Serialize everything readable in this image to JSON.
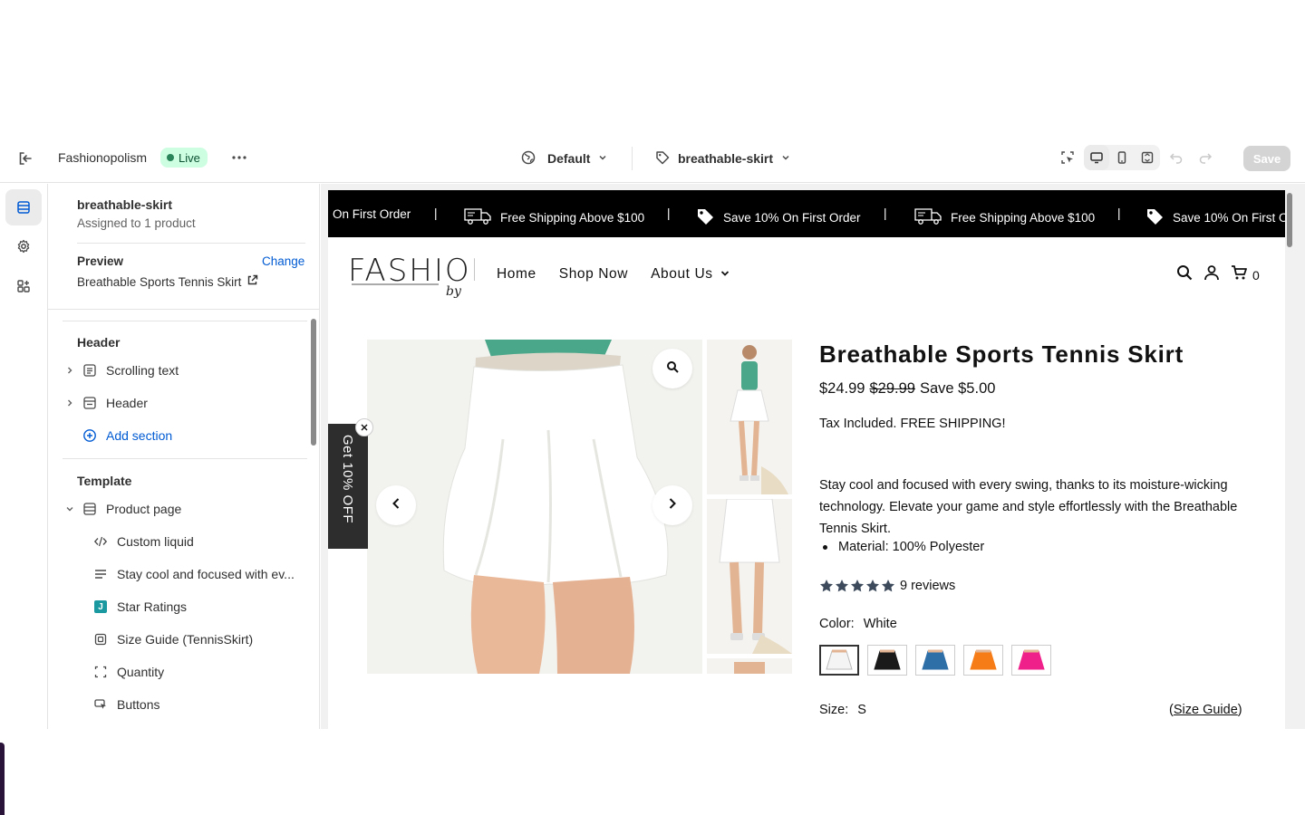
{
  "topbar": {
    "store_name": "Fashionopolism",
    "live_label": "Live",
    "theme_select": "Default",
    "template_select": "breathable-skirt",
    "save_label": "Save"
  },
  "sidebar": {
    "template_name": "breathable-skirt",
    "assigned": "Assigned to 1 product",
    "preview_label": "Preview",
    "change_label": "Change",
    "preview_product": "Breathable Sports Tennis Skirt",
    "header_section": "Header",
    "header_items": [
      {
        "label": "Scrolling text"
      },
      {
        "label": "Header"
      }
    ],
    "add_section": "Add section",
    "template_section": "Template",
    "product_page": "Product page",
    "blocks": [
      {
        "label": "Custom liquid"
      },
      {
        "label": "Stay cool and focused with ev..."
      },
      {
        "label": "Star Ratings"
      },
      {
        "label": "Size Guide (TennisSkirt)"
      },
      {
        "label": "Quantity"
      },
      {
        "label": "Buttons"
      }
    ],
    "jbadge": "J"
  },
  "store": {
    "announcements": [
      {
        "text": "On First Order"
      },
      {
        "text": "Free Shipping Above $100"
      },
      {
        "text": "Save 10% On First Order"
      },
      {
        "text": "Free Shipping Above $100"
      },
      {
        "text": "Save 10% On First O"
      }
    ],
    "separator": "|",
    "logo": "FASHION",
    "logo_sub": "by",
    "nav": [
      "Home",
      "Shop Now",
      "About Us"
    ],
    "cart_count": "0",
    "promo": "Get 10% OFF"
  },
  "product": {
    "title": "Breathable Sports Tennis Skirt",
    "price": "$24.99",
    "compare_price": "$29.99",
    "savings": "Save $5.00",
    "tax_note": "Tax Included. FREE SHIPPING!",
    "description": "Stay cool and focused with every swing, thanks to its moisture-wicking technology. Elevate your game and style effortlessly with the Breathable Tennis Skirt.",
    "material": "Material: 100% Polyester",
    "rating": 5,
    "reviews": "9 reviews",
    "color_label": "Color:",
    "color_value": "White",
    "swatches": [
      {
        "name": "White",
        "color": "#f4f4f4"
      },
      {
        "name": "Black",
        "color": "#1a1a1a"
      },
      {
        "name": "Blue",
        "color": "#2f6fa8"
      },
      {
        "name": "Orange",
        "color": "#f57c17"
      },
      {
        "name": "Pink",
        "color": "#f0208a"
      }
    ],
    "size_label": "Size:",
    "size_value": "S",
    "size_guide_open": "(",
    "size_guide": "Size Guide",
    "size_guide_close": ")"
  },
  "colors": {
    "live_bg": "#cdfee1",
    "link": "#005bd3",
    "announcement_bg": "#000000"
  }
}
